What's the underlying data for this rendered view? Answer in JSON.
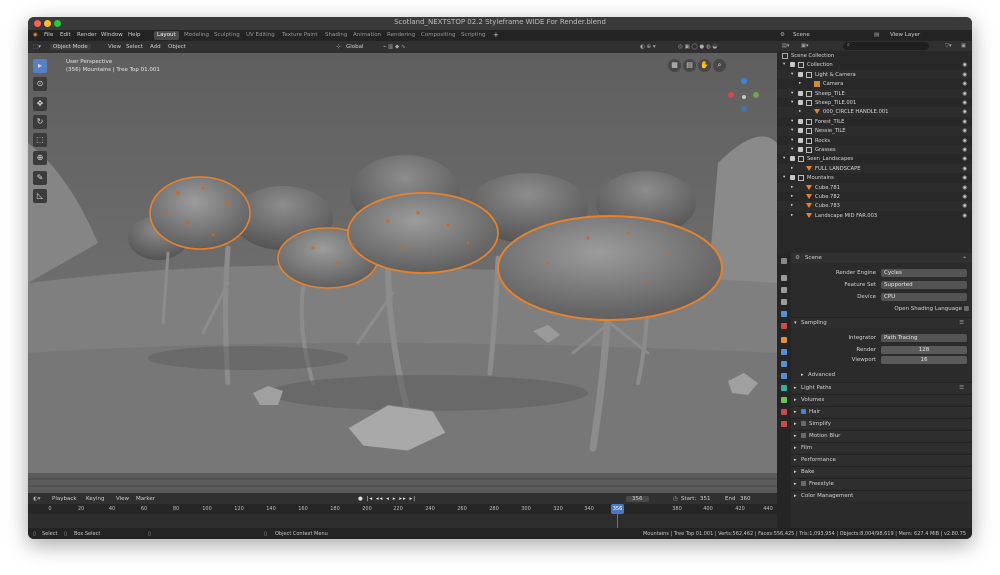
{
  "window": {
    "title": "Scotland_NEXTSTOP 02.2 Styleframe WIDE For Render.blend"
  },
  "menu": [
    "File",
    "Edit",
    "Render",
    "Window",
    "Help"
  ],
  "workspaces": [
    "Layout",
    "Modeling",
    "Sculpting",
    "UV Editing",
    "Texture Paint",
    "Shading",
    "Animation",
    "Rendering",
    "Compositing",
    "Scripting"
  ],
  "workspace_active": "Layout",
  "scene_selector": {
    "scene": "Scene",
    "view_layer": "View Layer"
  },
  "viewport_header": {
    "mode": "Object Mode",
    "items": [
      "View",
      "Select",
      "Add",
      "Object"
    ],
    "orientation": "Global"
  },
  "viewport": {
    "overlay_title": "User Perspective",
    "overlay_sub": "(356) Mountains | Tree Top 01.001"
  },
  "timeline": {
    "menu": [
      "Playback",
      "Keying",
      "View",
      "Marker"
    ],
    "current_frame": "356",
    "start_label": "Start:",
    "start": "351",
    "end_label": "End",
    "end": "360",
    "ticks": [
      "0",
      "20",
      "40",
      "60",
      "80",
      "100",
      "120",
      "140",
      "160",
      "180",
      "200",
      "220",
      "240",
      "260",
      "280",
      "300",
      "320",
      "340",
      "356",
      "380",
      "400",
      "420",
      "440"
    ]
  },
  "status": {
    "select": "Select",
    "box_select": "Box Select",
    "context": "Object Context Menu",
    "stats": "Mountains | Tree Top 01.001 | Verts:562,462 | Faces:556,425 | Tris:1,093,954 | Objects:8,004/98,619 | Mem: 627.4 MiB | v2.80.75"
  },
  "outliner": {
    "header": "Scene Collection",
    "rows": [
      {
        "label": "Collection",
        "indent": 1,
        "icon": "collection-icon"
      },
      {
        "label": "Light & Camera",
        "indent": 2,
        "icon": "collection-icon"
      },
      {
        "label": "Camera",
        "indent": 3,
        "icon": "camera-icon"
      },
      {
        "label": "Sheep_TILE",
        "indent": 2,
        "icon": "collection-icon"
      },
      {
        "label": "Sheep_TILE.001",
        "indent": 2,
        "icon": "collection-icon"
      },
      {
        "label": "000_CIRCLE HANDLE.001",
        "indent": 3,
        "icon": "mesh-icon"
      },
      {
        "label": "Forest_TILE",
        "indent": 2,
        "icon": "collection-icon"
      },
      {
        "label": "Nessie_TILE",
        "indent": 2,
        "icon": "collection-icon"
      },
      {
        "label": "Rocks",
        "indent": 2,
        "icon": "collection-icon"
      },
      {
        "label": "Grasses",
        "indent": 2,
        "icon": "collection-icon"
      },
      {
        "label": "Seen_Landscapes",
        "indent": 1,
        "icon": "collection-icon"
      },
      {
        "label": "FULL LANDSCAPE",
        "indent": 2,
        "icon": "mesh-icon"
      },
      {
        "label": "Mountains",
        "indent": 1,
        "icon": "collection-icon"
      },
      {
        "label": "Cube.781",
        "indent": 2,
        "icon": "mesh-icon"
      },
      {
        "label": "Cube.782",
        "indent": 2,
        "icon": "mesh-icon"
      },
      {
        "label": "Cube.783",
        "indent": 2,
        "icon": "mesh-icon"
      },
      {
        "label": "Landscape MID FAR.003",
        "indent": 2,
        "icon": "mesh-icon"
      }
    ]
  },
  "properties": {
    "context": "Scene",
    "render_engine_label": "Render Engine",
    "render_engine": "Cycles",
    "feature_set_label": "Feature Set",
    "feature_set": "Supported",
    "device_label": "Device",
    "device": "CPU",
    "osl_label": "Open Shading Language",
    "sampling": "Sampling",
    "integrator_label": "Integrator",
    "integrator": "Path Tracing",
    "render_label": "Render",
    "render_samples": "128",
    "viewport_label": "Viewport",
    "viewport_samples": "16",
    "advanced": "Advanced",
    "panels": [
      "Light Paths",
      "Volumes",
      "Hair",
      "Simplify",
      "Motion Blur",
      "Film",
      "Performance",
      "Bake",
      "Freestyle",
      "Color Management"
    ]
  },
  "colors": {
    "selection": "#e6822e",
    "accent": "#4a78c6",
    "bg": "#2b2b2b"
  }
}
